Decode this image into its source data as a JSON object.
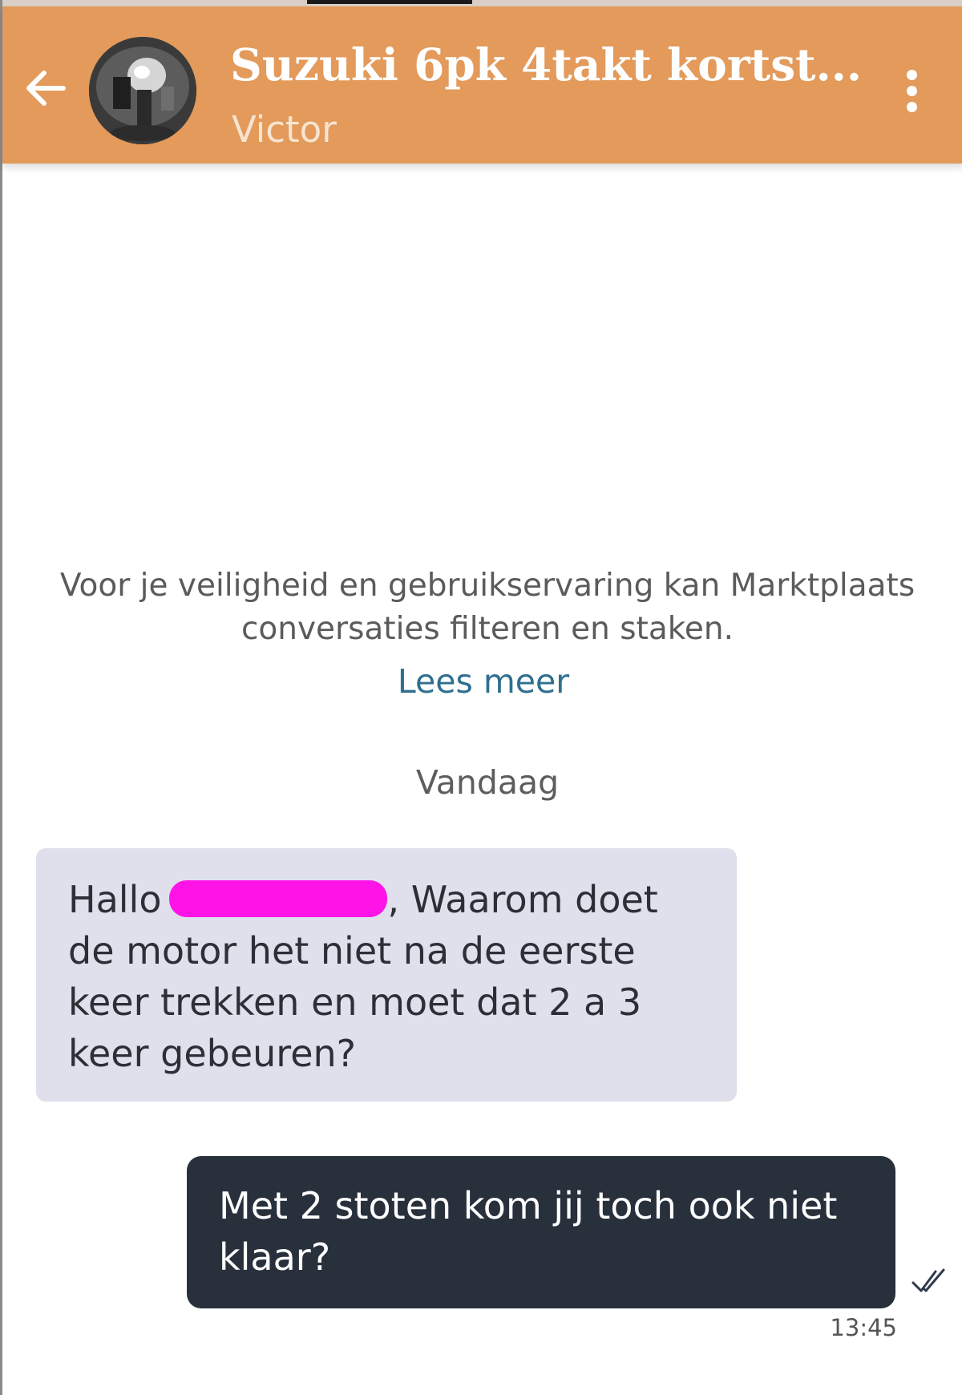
{
  "header": {
    "title": "Suzuki 6pk 4takt kortst...",
    "subtitle": "Victor",
    "background_color": "#e39a5a",
    "back_icon": "arrow-left-icon",
    "menu_icon": "more-vertical-icon"
  },
  "notice": {
    "text": "Voor je veiligheid en gebruikservaring kan Marktplaats conversaties filteren en staken.",
    "link_label": "Lees meer"
  },
  "day_separator": "Vandaag",
  "messages": [
    {
      "direction": "incoming",
      "greeting": "Hallo",
      "body": ", Waarom doet de motor het niet na de eerste keer trekken en moet dat 2 a 3 keer gebeuren?"
    },
    {
      "direction": "outgoing",
      "body": "Met 2 stoten kom jij toch ook niet klaar?",
      "time": "13:45",
      "status_icon": "double-check-icon"
    }
  ]
}
